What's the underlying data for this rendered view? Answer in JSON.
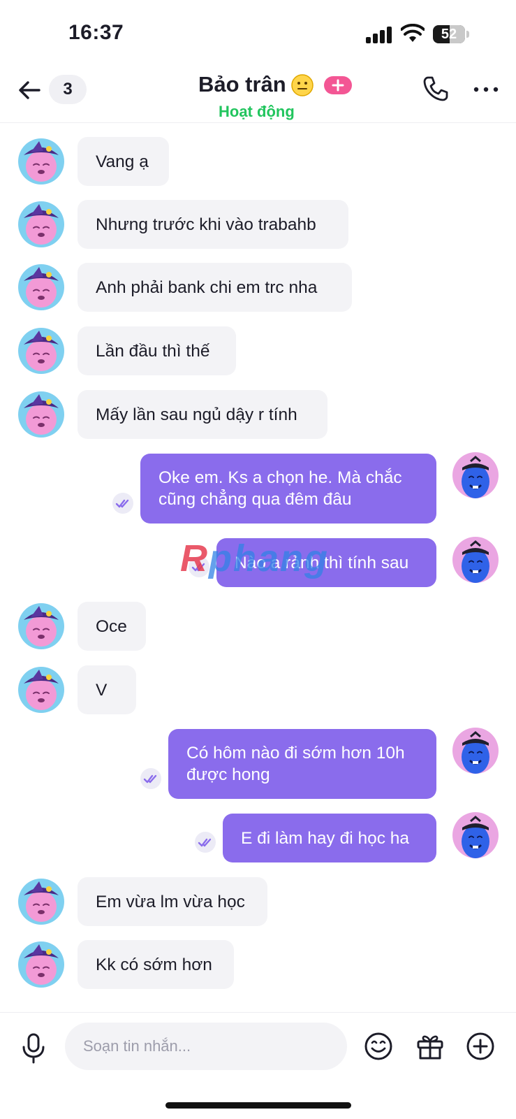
{
  "status_bar": {
    "time": "16:37",
    "battery": "52"
  },
  "header": {
    "unread_count": "3",
    "contact_name": "Bảo trân",
    "status": "Hoạt động"
  },
  "messages": [
    {
      "side": "in",
      "text": "Vang ạ"
    },
    {
      "side": "in",
      "text": "Nhưng trước khi vào trabahb"
    },
    {
      "side": "in",
      "text": "Anh phải bank chi em trc nha"
    },
    {
      "side": "in",
      "text": "Lần đầu thì thế"
    },
    {
      "side": "in",
      "text": "Mấy lần sau ngủ dậy r tính"
    },
    {
      "side": "out",
      "text": "Oke em. Ks a chọn he. Mà chắc\ncũng chẳng qua đêm đâu"
    },
    {
      "side": "out",
      "text": "Nào a rảnh thì tính sau"
    },
    {
      "side": "in",
      "text": "Oce"
    },
    {
      "side": "in",
      "text": "V"
    },
    {
      "side": "out",
      "text": "Có hôm nào đi sớm hơn 10h\nđược hong"
    },
    {
      "side": "out",
      "text": "E đi làm hay đi học ha"
    },
    {
      "side": "in",
      "text": "Em vừa lm vừa học"
    },
    {
      "side": "in",
      "text": "Kk có sớm hơn"
    }
  ],
  "watermark": {
    "part1": "R",
    "part2": "phang"
  },
  "composer": {
    "placeholder": "Soạn tin nhắn..."
  },
  "colors": {
    "outgoing_bubble": "#8a6cec",
    "incoming_bubble": "#f3f3f6",
    "status_active": "#22c55e",
    "plus_badge": "#f35694"
  },
  "icons": [
    "back-arrow-icon",
    "phone-icon",
    "more-icon",
    "neutral-face-emoji-icon",
    "plus-icon",
    "microphone-icon",
    "smiley-icon",
    "gift-icon",
    "add-circle-icon",
    "double-check-icon"
  ]
}
